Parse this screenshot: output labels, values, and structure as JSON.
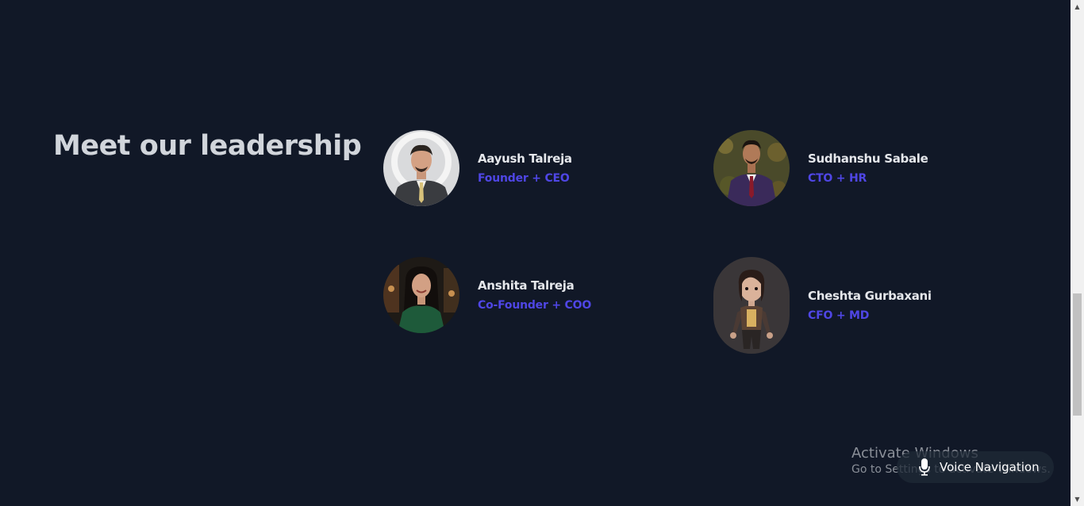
{
  "section": {
    "title": "Meet our leadership"
  },
  "leaders": [
    {
      "name": "Aayush Talreja",
      "role": "Founder + CEO",
      "photo": "man-in-suit-photo"
    },
    {
      "name": "Sudhanshu Sabale",
      "role": "CTO + HR",
      "photo": "man-in-purple-suit-photo"
    },
    {
      "name": "Anshita Talreja",
      "role": "Co-Founder + COO",
      "photo": "woman-in-green-photo"
    },
    {
      "name": "Cheshta Gurbaxani",
      "role": "CFO + MD",
      "photo": "3d-avatar-woman"
    }
  ],
  "voice_navigation": {
    "label": "Voice Navigation",
    "icon": "microphone-icon"
  },
  "watermark": {
    "title": "Activate Windows",
    "subtitle": "Go to Settings to activate Windows."
  },
  "colors": {
    "background": "#111827",
    "accent": "#4f46e5",
    "heading": "#d1d5db"
  }
}
